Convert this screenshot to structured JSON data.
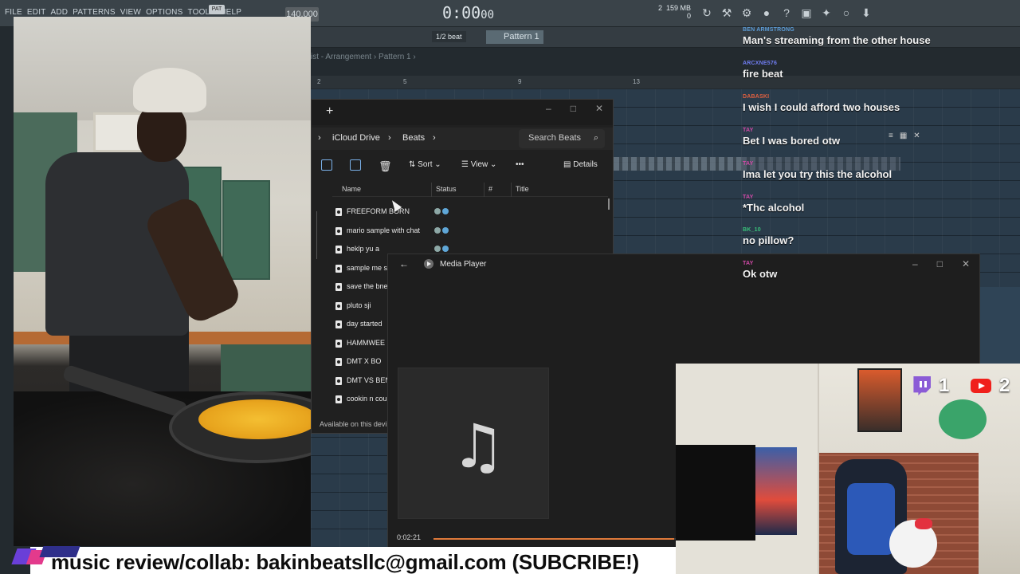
{
  "fl": {
    "menu": [
      "FILE",
      "EDIT",
      "ADD",
      "PATTERNS",
      "VIEW",
      "OPTIONS",
      "TOOLS",
      "HELP"
    ],
    "pat_label": "PAT",
    "tempo": "140.000",
    "time": "0:00",
    "time_frac": "00",
    "time_unit": "M:S:CS",
    "mem": "159 MB",
    "mem_val": "0",
    "cpu": "2",
    "snap": "1/2 beat",
    "pattern": "Pattern 1",
    "breadcrumb": "ist - Arrangement › Pattern 1 ›",
    "ruler": [
      "2",
      "5",
      "9",
      "13"
    ]
  },
  "explorer": {
    "path": [
      "iCloud Drive",
      "Beats"
    ],
    "search_placeholder": "Search Beats",
    "toolbar": {
      "sort": "Sort",
      "view": "View",
      "more": "•••",
      "details": "Details"
    },
    "columns": [
      "Name",
      "Status",
      "#",
      "Title"
    ],
    "files": [
      "FREEFORM BORN",
      "mario sample with chat",
      "heklp yu a",
      "sample me s",
      "save the bne",
      "pluto sji",
      "day started",
      "HAMMWEE I",
      "DMT X BO",
      "DMT VS BEN",
      "cookin n cou"
    ],
    "footer": "Available on this devi"
  },
  "media": {
    "title": "Media Player",
    "elapsed": "0:02:21",
    "progress_fraction": 0.44
  },
  "chat": [
    {
      "user": "BEN ARMSTRONG",
      "color": "#5b9bd5",
      "text": "Man's streaming from the other house"
    },
    {
      "user": "ARCXNE576",
      "color": "#6f7cf0",
      "text": "fire beat"
    },
    {
      "user": "DABASKI",
      "color": "#e06040",
      "text": "I wish I could afford two houses"
    },
    {
      "user": "TAY",
      "color": "#d24aa8",
      "text": "Bet I was bored otw"
    },
    {
      "user": "TAY",
      "color": "#d24aa8",
      "text": "Ima let you try this the alcohol"
    },
    {
      "user": "TAY",
      "color": "#d24aa8",
      "text": "*Thc alcohol"
    },
    {
      "user": "BK_10",
      "color": "#39c27a",
      "text": "no pillow?"
    },
    {
      "user": "TAY",
      "color": "#d24aa8",
      "text": "Ok otw"
    }
  ],
  "socials": {
    "twitch_count": "1",
    "youtube_count": "2"
  },
  "banner": {
    "text": "music review/collab: bakinbeatsllc@gmail.com (SUBCRIBE!)"
  },
  "colors": {
    "accent": "#e07a3a",
    "explorer_bg": "#202020",
    "chat_text": "#f2f2f2"
  }
}
